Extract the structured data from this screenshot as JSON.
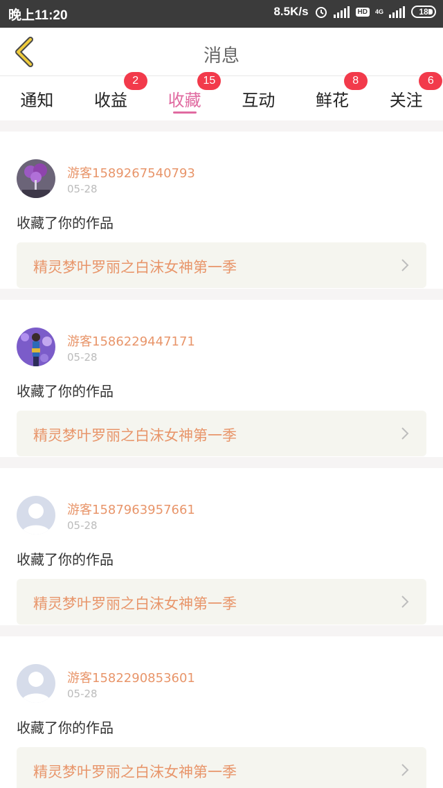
{
  "status_bar": {
    "time": "晚上11:20",
    "net_speed": "8.5K/s",
    "hd": "HD",
    "net_type": "4G",
    "battery": "18"
  },
  "header": {
    "title": "消息",
    "back_icon": "chevron-left-icon"
  },
  "tabs": [
    {
      "label": "通知",
      "badge": null,
      "active": false
    },
    {
      "label": "收益",
      "badge": "2",
      "active": false
    },
    {
      "label": "收藏",
      "badge": "15",
      "active": true
    },
    {
      "label": "互动",
      "badge": null,
      "active": false
    },
    {
      "label": "鲜花",
      "badge": "8",
      "active": false
    },
    {
      "label": "关注",
      "badge": "6",
      "active": false
    }
  ],
  "items": [
    {
      "username": "游客1589267540793",
      "date": "05-28",
      "action": "收藏了你的作品",
      "work": "精灵梦叶罗丽之白沫女神第一季",
      "avatar": "purple-flower-avatar"
    },
    {
      "username": "游客1586229447171",
      "date": "05-28",
      "action": "收藏了你的作品",
      "work": "精灵梦叶罗丽之白沫女神第一季",
      "avatar": "doll-avatar"
    },
    {
      "username": "游客1587963957661",
      "date": "05-28",
      "action": "收藏了你的作品",
      "work": "精灵梦叶罗丽之白沫女神第一季",
      "avatar": "default-avatar"
    },
    {
      "username": "游客1582290853601",
      "date": "05-28",
      "action": "收藏了你的作品",
      "work": "精灵梦叶罗丽之白沫女神第一季",
      "avatar": "default-avatar"
    }
  ],
  "colors": {
    "accent_pink": "#e06aa0",
    "badge_red": "#f23a4b",
    "username_orange": "#e8956a",
    "back_arrow_yellow": "#f0cc3c"
  }
}
